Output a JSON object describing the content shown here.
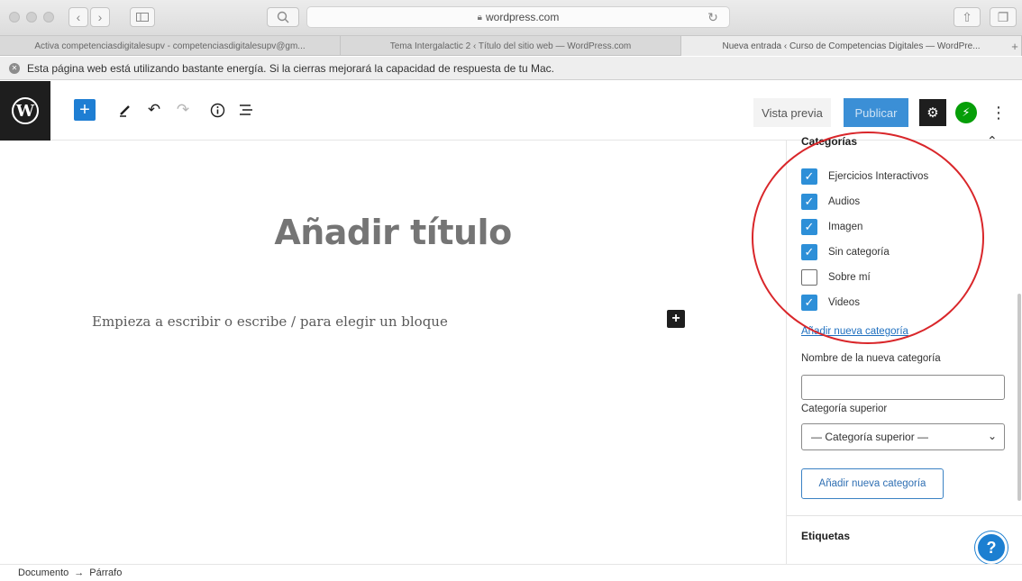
{
  "browser": {
    "address": "wordpress.com",
    "tabs": [
      "Activa competenciasdigitalesupv - competenciasdigitalesupv@gm...",
      "Tema Intergalactic 2 ‹ Título del sitio web — WordPress.com",
      "Nueva entrada ‹ Curso de Competencias Digitales — WordPre..."
    ],
    "active_tab": 2,
    "new_tab": "+",
    "warning": "Esta página web está utilizando bastante energía. Si la cierras mejorará la capacidad de respuesta de tu Mac."
  },
  "toolbar": {
    "logo": "W",
    "add_block": "+",
    "preview_label": "Vista previa",
    "publish_label": "Publicar",
    "settings_icon": "gear-icon",
    "jetpack_icon": "jetpack-icon",
    "more_icon": "more-vertical-icon"
  },
  "editor": {
    "title_placeholder": "Añadir título",
    "paragraph_placeholder": "Empieza a escribir o escribe / para elegir un bloque",
    "inserter": "+"
  },
  "sidebar": {
    "panel_title": "Categorías",
    "categories": [
      {
        "label": "Ejercicios Interactivos",
        "checked": true
      },
      {
        "label": "Audios",
        "checked": true
      },
      {
        "label": "Imagen",
        "checked": true
      },
      {
        "label": "Sin categoría",
        "checked": true
      },
      {
        "label": "Sobre mí",
        "checked": false
      },
      {
        "label": "Videos",
        "checked": true
      }
    ],
    "add_category_link": "Añadir nueva categoría",
    "new_category_label": "Nombre de la nueva categoría",
    "new_category_value": "",
    "parent_label": "Categoría superior",
    "parent_selected": "— Categoría superior —",
    "add_category_button": "Añadir nueva categoría",
    "tags_title": "Etiquetas"
  },
  "footer": {
    "crumb_document": "Documento",
    "crumb_separator": "→",
    "crumb_block": "Párrafo"
  },
  "colors": {
    "accent": "#2d8fd8",
    "publish": "#3b8fd6",
    "highlight": "#d9262a",
    "jetpack": "#069e08"
  }
}
